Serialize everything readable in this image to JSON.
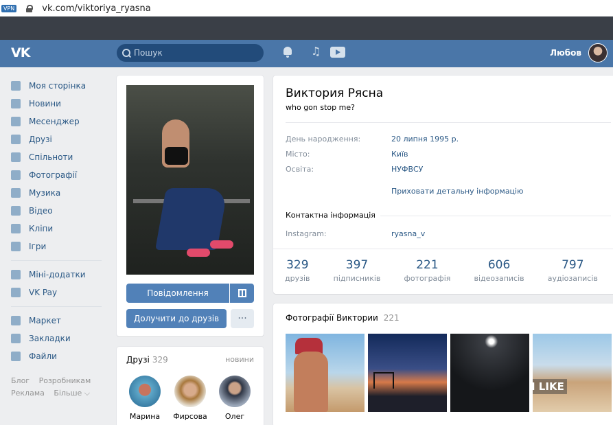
{
  "browser": {
    "vpn_badge": "VPN",
    "url": "vk.com/viktoriya_ryasna"
  },
  "header": {
    "logo": "VK",
    "search_placeholder": "Пошук",
    "user_name": "Любов"
  },
  "nav": {
    "items": [
      {
        "label": "Моя сторінка",
        "icon": "home-icon"
      },
      {
        "label": "Новини",
        "icon": "news-icon"
      },
      {
        "label": "Месенджер",
        "icon": "messenger-icon"
      },
      {
        "label": "Друзі",
        "icon": "friends-icon"
      },
      {
        "label": "Спільноти",
        "icon": "communities-icon"
      },
      {
        "label": "Фотографії",
        "icon": "photos-icon"
      },
      {
        "label": "Музика",
        "icon": "music-icon"
      },
      {
        "label": "Відео",
        "icon": "video-icon"
      },
      {
        "label": "Кліпи",
        "icon": "clips-icon"
      },
      {
        "label": "Ігри",
        "icon": "games-icon"
      }
    ],
    "items2": [
      {
        "label": "Міні-додатки",
        "icon": "apps-icon"
      },
      {
        "label": "VK Pay",
        "icon": "vkpay-icon"
      }
    ],
    "items3": [
      {
        "label": "Маркет",
        "icon": "market-icon"
      },
      {
        "label": "Закладки",
        "icon": "bookmarks-icon"
      },
      {
        "label": "Файли",
        "icon": "files-icon"
      }
    ],
    "footer": {
      "blog": "Блог",
      "developers": "Розробникам",
      "ads": "Реклама",
      "more": "Більше ⌵"
    }
  },
  "photo_card": {
    "message_button": "Повідомлення",
    "add_friend_button": "Долучити до друзів",
    "more_button": "···"
  },
  "friends": {
    "title": "Друзі",
    "count": "329",
    "updates": "новини",
    "list": [
      {
        "name": "Марина"
      },
      {
        "name": "Фирсова"
      },
      {
        "name": "Олег"
      }
    ]
  },
  "profile": {
    "name": "Виктория Рясна",
    "status": "who gon stop me?",
    "birthday_label": "День народження:",
    "birthday": "20 липня 1995 р.",
    "city_label": "Місто:",
    "city": "Київ",
    "education_label": "Освіта:",
    "education": "НУФВСУ",
    "hide_details": "Приховати детальну інформацію",
    "contacts_title": "Контактна інформація",
    "instagram_label": "Instagram:",
    "instagram": "ryasna_v",
    "stats": [
      {
        "num": "329",
        "label": "друзів"
      },
      {
        "num": "397",
        "label": "підписників"
      },
      {
        "num": "221",
        "label": "фотографія"
      },
      {
        "num": "606",
        "label": "відеозаписів"
      },
      {
        "num": "797",
        "label": "аудіозаписів"
      }
    ]
  },
  "photos": {
    "title": "Фотографії Виктории",
    "count": "221",
    "watermark": "I LIKE"
  }
}
